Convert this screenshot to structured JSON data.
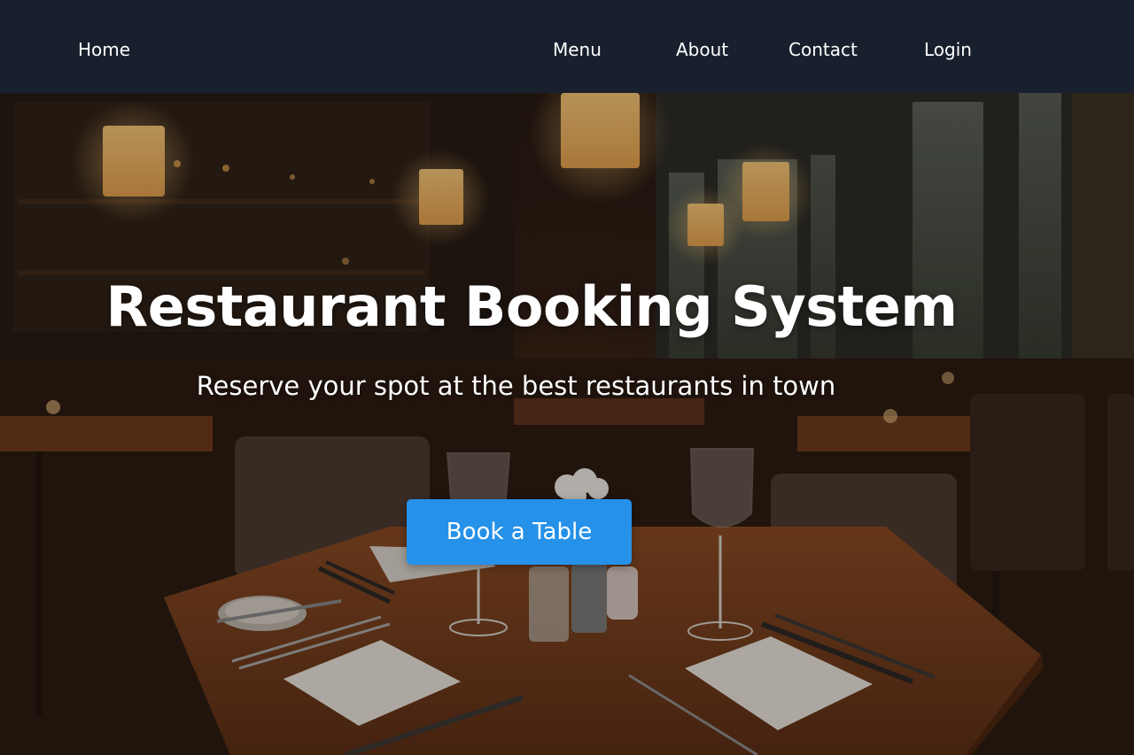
{
  "nav": {
    "home": "Home",
    "menu": "Menu",
    "about": "About",
    "contact": "Contact",
    "login": "Login"
  },
  "hero": {
    "title": "Restaurant Booking System",
    "subtitle": "Reserve your spot at the best restaurants in town",
    "cta_label": "Book a Table",
    "background_image": "restaurant-interior-photo"
  },
  "colors": {
    "navbar": "#18202d",
    "cta": "#2591e9",
    "text": "#ffffff"
  }
}
